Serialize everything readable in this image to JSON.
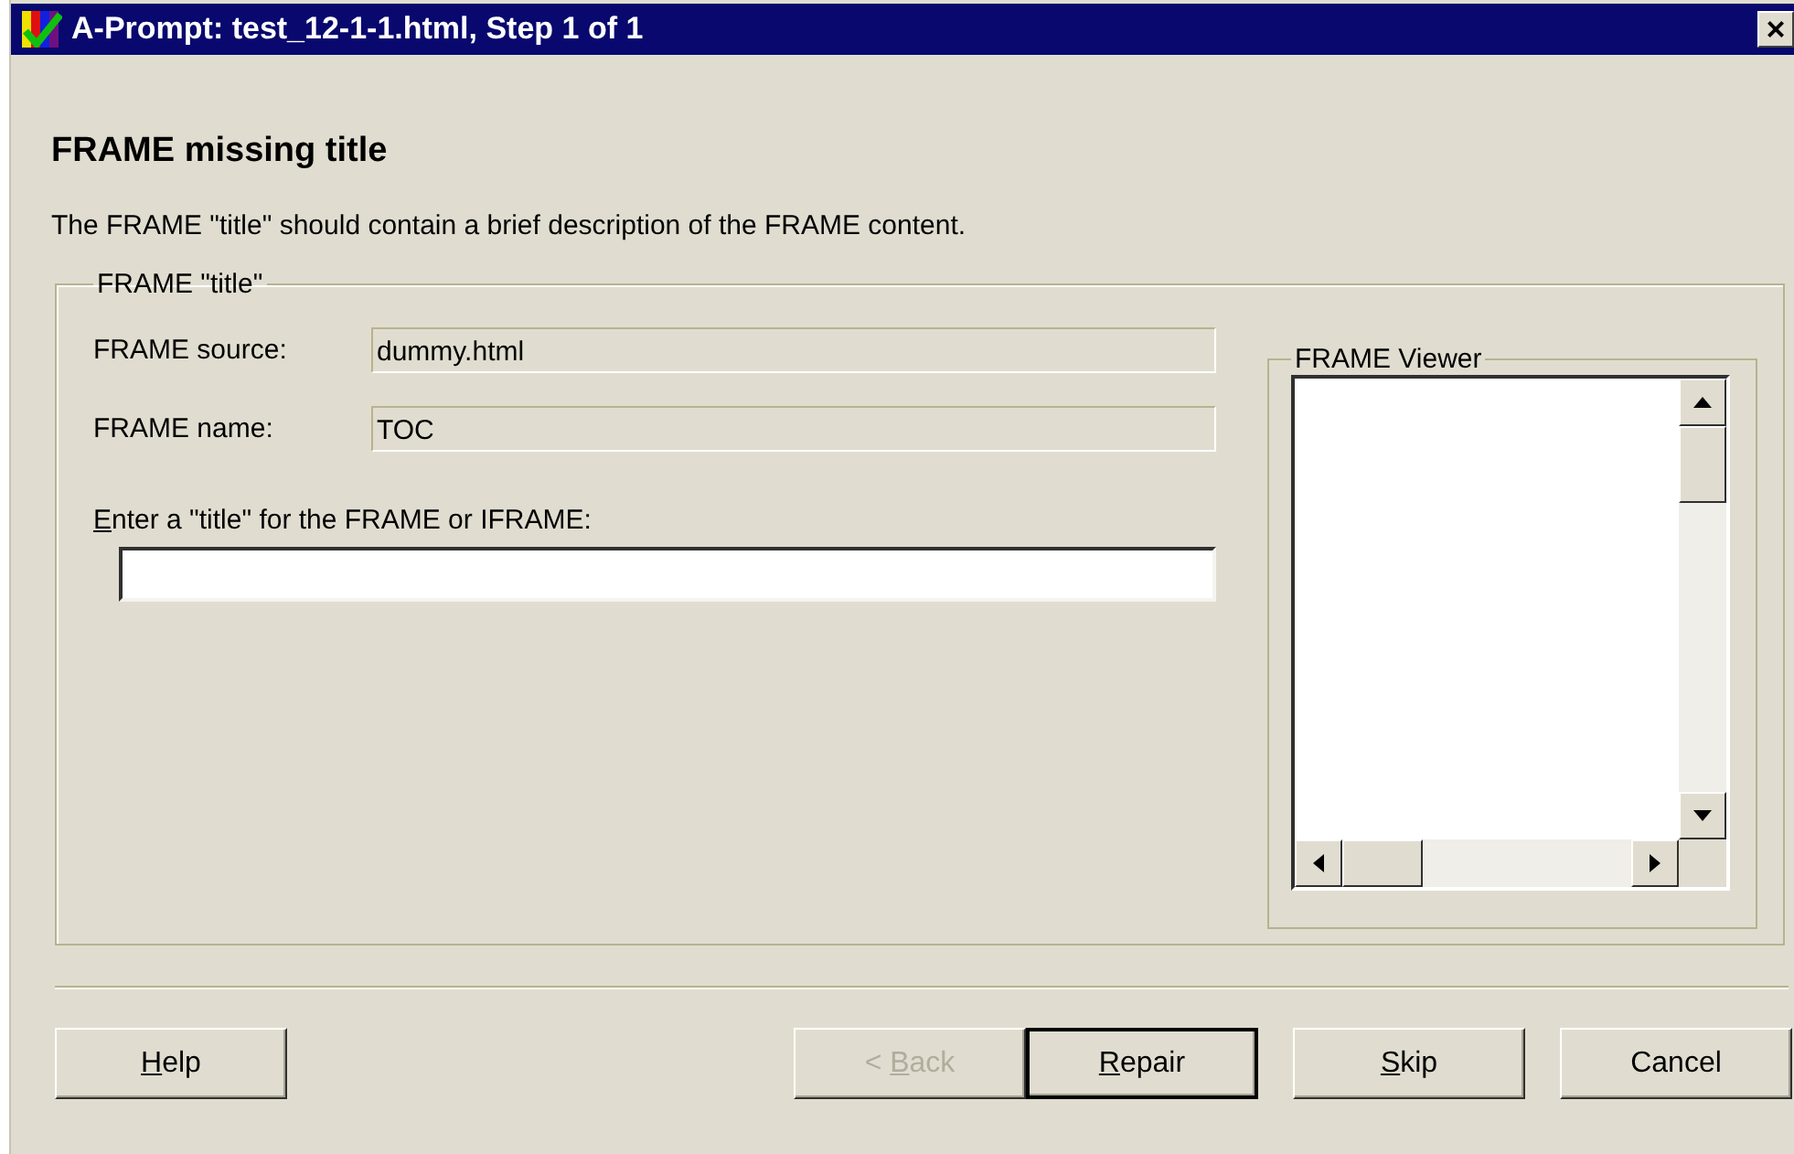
{
  "window": {
    "title": "A-Prompt: test_12-1-1.html, Step 1 of 1",
    "close": "×"
  },
  "heading": "FRAME missing title",
  "description": "The FRAME \"title\" should contain a brief description of the FRAME content.",
  "group": {
    "legend": "FRAME \"title\"",
    "fields": [
      {
        "label": "FRAME source:",
        "value": "dummy.html",
        "disabled": true
      },
      {
        "label": "FRAME name:",
        "value": "TOC",
        "disabled": true
      }
    ],
    "entry": {
      "label": {
        "key": "E",
        "after": "nter a \"title\" for the FRAME or IFRAME:"
      }
    },
    "viewer": {
      "legend": "FRAME Viewer"
    }
  },
  "buttons_left": [
    {
      "label": {
        "key": "H",
        "after": "elp"
      },
      "disabled": false,
      "default": false
    }
  ],
  "buttons_right": [
    {
      "label": {
        "before": "< ",
        "key": "B",
        "after": "ack"
      },
      "disabled": true,
      "default": false
    },
    {
      "label": {
        "key": "R",
        "after": "epair"
      },
      "disabled": false,
      "default": true
    },
    {
      "label": {
        "key": "S",
        "after": "kip"
      },
      "disabled": false,
      "default": false
    },
    {
      "label": "Cancel",
      "disabled": false,
      "default": false
    }
  ]
}
